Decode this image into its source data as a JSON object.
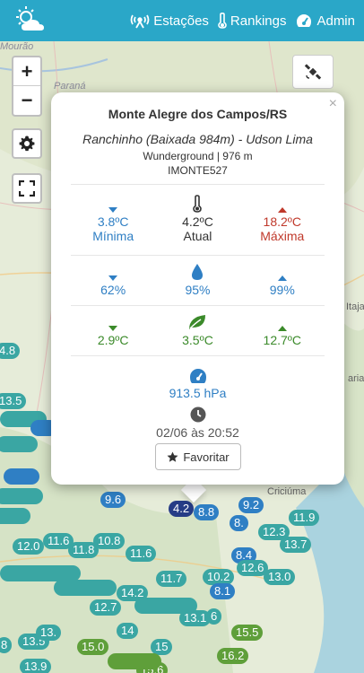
{
  "header": {
    "nav": [
      {
        "label": "Estações",
        "icon": "antenna-icon"
      },
      {
        "label": "Rankings",
        "icon": "thermometer-icon"
      },
      {
        "label": "Admin",
        "icon": "gauge-icon"
      }
    ]
  },
  "map": {
    "labels": {
      "mourao": "Mourão",
      "parana": "Paraná",
      "itaja": "Itaja",
      "criciuma": "Criciúma",
      "aria": "aria"
    },
    "zoom_in": "+",
    "zoom_out": "−",
    "markers": [
      "4.8",
      "13.5",
      "9.6",
      "4.2",
      "8.8",
      "9.2",
      "8.",
      "11.9",
      "12.3",
      "13.7",
      "8.4",
      "12.6",
      "13.0",
      "10.2",
      "8.1",
      "13.1",
      "15.5",
      "16.2",
      "12.0",
      "11.6",
      "11.8",
      "10.8",
      "11.6",
      "11.7",
      "12.7",
      "13.5",
      "15.0",
      "13.9",
      "15.6",
      "14.2",
      "13.",
      "14",
      "15",
      "8",
      "6"
    ]
  },
  "popup": {
    "close": "×",
    "title": "Monte Alegre dos Campos/RS",
    "station": "Ranchinho (Baixada 984m) - Udson Lima",
    "source": "Wunderground | 976 m",
    "code": "IMONTE527",
    "temp": {
      "min": "3.8ºC",
      "min_label": "Mínima",
      "current": "4.2ºC",
      "current_label": "Atual",
      "max": "18.2ºC",
      "max_label": "Máxima"
    },
    "humidity": {
      "min": "62%",
      "current": "95%",
      "max": "99%"
    },
    "dewpoint": {
      "min": "2.9ºC",
      "current": "3.5ºC",
      "max": "12.7ºC"
    },
    "pressure": "913.5 hPa",
    "timestamp": "02/06 às 20:52",
    "favorite_label": "Favoritar"
  },
  "colors": {
    "header": "#2aa7c8",
    "teal": "#3aa6a3",
    "blue": "#2f7fc4",
    "red": "#c0392b",
    "green": "#3b8a2a"
  }
}
